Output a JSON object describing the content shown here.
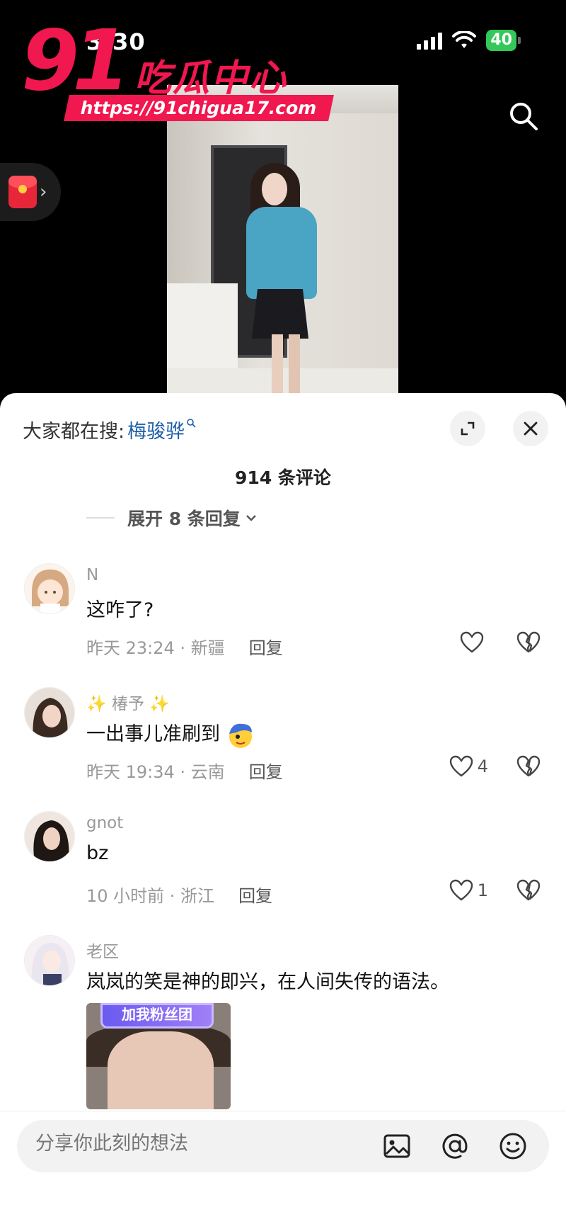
{
  "status_bar": {
    "time": "3:30",
    "battery": "40"
  },
  "watermark": {
    "number": "91",
    "name": "吃瓜中心",
    "url": "https://91chigua17.com"
  },
  "icons": {
    "search": "search-icon",
    "red_packet": "red-packet-icon",
    "expand": "expand-icon",
    "close": "close-icon",
    "heart": "heart-icon",
    "broken_heart": "broken-heart-icon",
    "image": "image-icon",
    "at": "at-icon",
    "emoji": "emoji-icon"
  },
  "sheet": {
    "hot_search_label": "大家都在搜:",
    "hot_search_term": "梅骏骅",
    "comment_count": "914 条评论",
    "expand_replies": "展开 8 条回复"
  },
  "comments": [
    {
      "name": "N",
      "text": "这咋了?",
      "meta": "昨天 23:24 · 新疆",
      "reply": "回复",
      "likes": ""
    },
    {
      "name": "✨ 椿予 ✨",
      "text": "一出事儿准刷到",
      "meta": "昨天 19:34 · 云南",
      "reply": "回复",
      "likes": "4"
    },
    {
      "name": "gnot",
      "text": "bz",
      "meta": "10 小时前 · 浙江",
      "reply": "回复",
      "likes": "1"
    },
    {
      "name": "老区",
      "text": "岚岚的笑是神的即兴，在人间失传的语法。",
      "image_banner": "加我粉丝团"
    }
  ],
  "input": {
    "placeholder": "分享你此刻的想法"
  },
  "colors": {
    "brand": "#f1174f",
    "link": "#1f5fa8",
    "battery": "#34c759"
  }
}
